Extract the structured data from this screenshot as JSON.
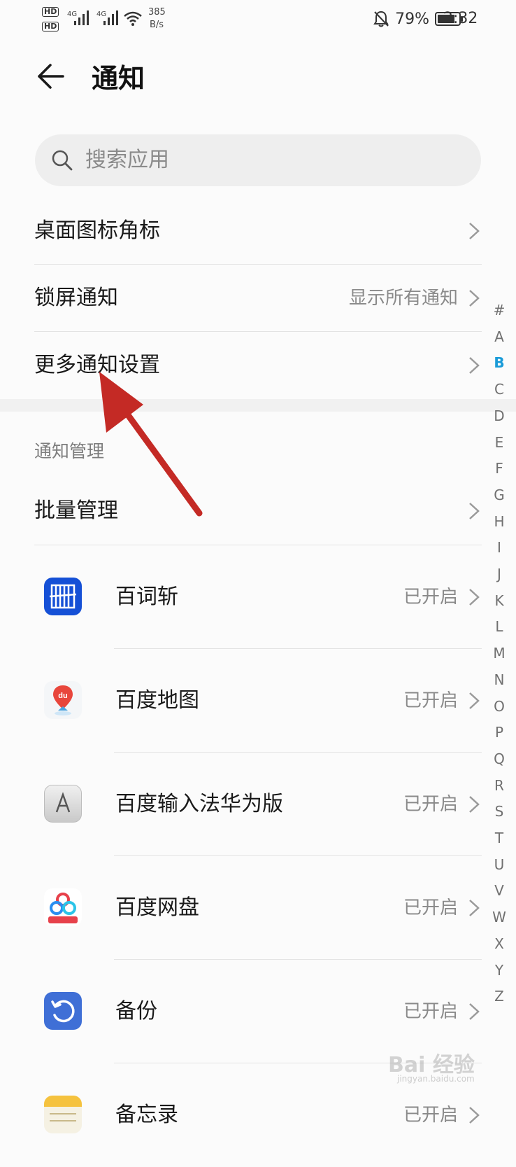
{
  "status_bar": {
    "hd1": "HD",
    "hd2": "HD",
    "net1": "4G",
    "net2": "4G",
    "speed_value": "385",
    "speed_unit": "B/s",
    "battery": "79%",
    "time": "2:32"
  },
  "header": {
    "title": "通知",
    "back_icon": "arrow-left-icon"
  },
  "search": {
    "placeholder": "搜索应用"
  },
  "settings_rows": [
    {
      "label": "桌面图标角标",
      "value": ""
    },
    {
      "label": "锁屏通知",
      "value": "显示所有通知"
    },
    {
      "label": "更多通知设置",
      "value": ""
    }
  ],
  "section": {
    "title": "通知管理"
  },
  "batch": {
    "label": "批量管理"
  },
  "apps": [
    {
      "name": "百词斩",
      "status": "已开启",
      "icon": "baicizhan-icon",
      "color": "#1550d6"
    },
    {
      "name": "百度地图",
      "status": "已开启",
      "icon": "baidu-map-icon",
      "color": "#e8463c"
    },
    {
      "name": "百度输入法华为版",
      "status": "已开启",
      "icon": "baidu-input-icon",
      "color": "#cfcfcf"
    },
    {
      "name": "百度网盘",
      "status": "已开启",
      "icon": "baidu-netdisk-icon",
      "color": "#2b8ef0"
    },
    {
      "name": "备份",
      "status": "已开启",
      "icon": "backup-icon",
      "color": "#3f6fd6"
    },
    {
      "name": "备忘录",
      "status": "已开启",
      "icon": "memo-icon",
      "color": "#f5c23e"
    }
  ],
  "index_letters": [
    "#",
    "A",
    "B",
    "C",
    "D",
    "E",
    "F",
    "G",
    "H",
    "I",
    "J",
    "K",
    "L",
    "M",
    "N",
    "O",
    "P",
    "Q",
    "R",
    "S",
    "T",
    "U",
    "V",
    "W",
    "X",
    "Y",
    "Z"
  ],
  "index_active": "B",
  "watermark": {
    "text": "Bai 经验",
    "url": "jingyan.baidu.com"
  },
  "colors": {
    "accent": "#1a9bd8",
    "annotation_arrow": "#c42a25"
  }
}
